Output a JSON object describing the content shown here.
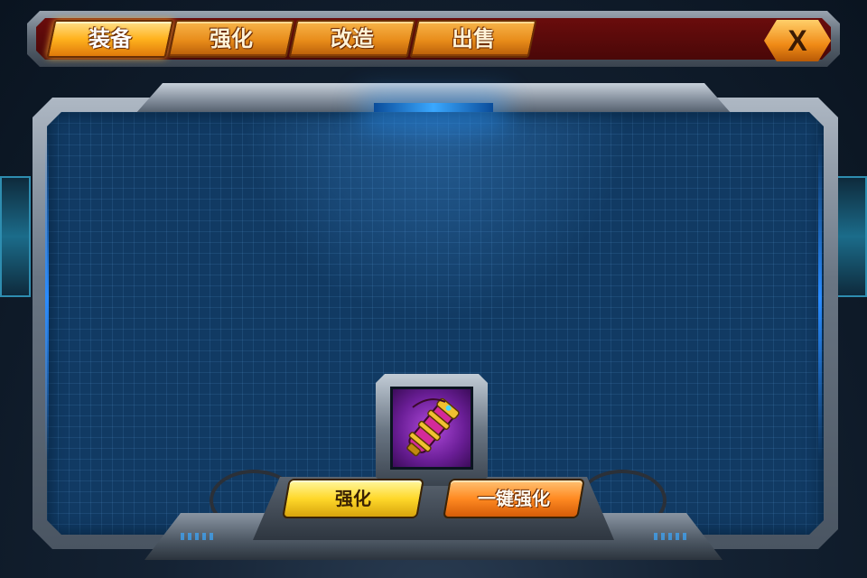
{
  "tabs": [
    {
      "label": "装备",
      "active": true
    },
    {
      "label": "强化",
      "active": false
    },
    {
      "label": "改造",
      "active": false
    },
    {
      "label": "出售",
      "active": false
    }
  ],
  "close_label": "X",
  "equipment_slot": {
    "item_icon": "purple-cannon-icon"
  },
  "buttons": {
    "enhance_label": "强化",
    "one_click_label": "一键强化"
  },
  "colors": {
    "tab_orange": "#f0a030",
    "tab_active": "#ffb21e",
    "topbar_red": "#5a0a0a",
    "panel_blue": "#113a63",
    "enhance_yellow": "#ffd82a",
    "one_click_orange": "#ff8a22"
  }
}
